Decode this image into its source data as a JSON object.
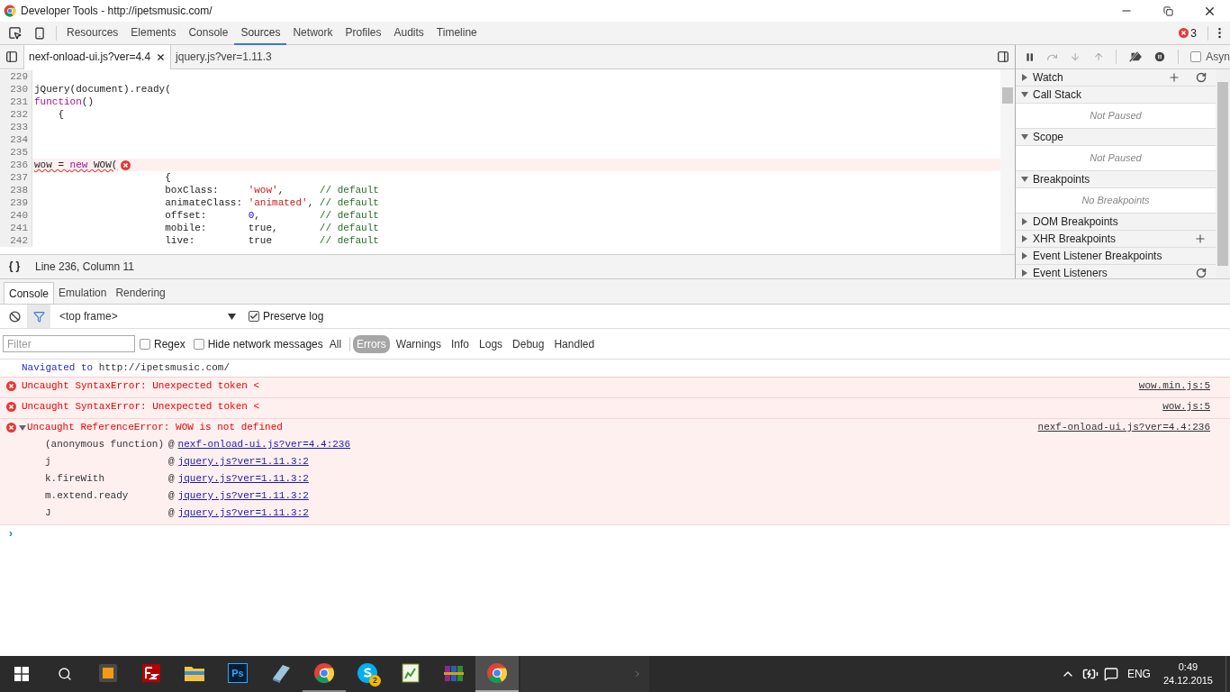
{
  "window": {
    "title": "Developer Tools - http://ipetsmusic.com/"
  },
  "main_tabs": [
    {
      "label": "Resources",
      "selected": false
    },
    {
      "label": "Elements",
      "selected": false
    },
    {
      "label": "Console",
      "selected": false
    },
    {
      "label": "Sources",
      "selected": true
    },
    {
      "label": "Network",
      "selected": false
    },
    {
      "label": "Profiles",
      "selected": false
    },
    {
      "label": "Audits",
      "selected": false
    },
    {
      "label": "Timeline",
      "selected": false
    }
  ],
  "error_count": "3",
  "file_tabs": [
    {
      "label": "nexf-onload-ui.js?ver=4.4",
      "selected": true,
      "closable": true
    },
    {
      "label": "jquery.js?ver=1.11.3",
      "selected": false,
      "closable": false
    }
  ],
  "code_lines": [
    {
      "number": "229",
      "error": false
    },
    {
      "number": "230",
      "error": false,
      "segments": [
        {
          "kind": "plain",
          "text": "jQuery(document).ready("
        }
      ]
    },
    {
      "number": "231",
      "error": false,
      "segments": [
        {
          "kind": "keyword",
          "text": "function"
        },
        {
          "kind": "plain",
          "text": "()"
        }
      ]
    },
    {
      "number": "232",
      "error": false,
      "segments": [
        {
          "kind": "plain",
          "text": "    {"
        }
      ]
    },
    {
      "number": "233",
      "error": false
    },
    {
      "number": "234",
      "error": false
    },
    {
      "number": "235",
      "error": false
    },
    {
      "number": "236",
      "error": true,
      "segments": [
        {
          "kind": "plain",
          "text": "wow = "
        },
        {
          "kind": "keyword",
          "text": "new"
        },
        {
          "kind": "plain",
          "text": " WOW("
        }
      ]
    },
    {
      "number": "237",
      "error": false,
      "segments": [
        {
          "kind": "plain",
          "text": "                      {"
        }
      ]
    },
    {
      "number": "238",
      "error": false,
      "segments": [
        {
          "kind": "plain",
          "text": "                      boxClass:     "
        },
        {
          "kind": "string",
          "text": "'wow'"
        },
        {
          "kind": "plain",
          "text": ",      "
        },
        {
          "kind": "comment",
          "text": "// default"
        }
      ]
    },
    {
      "number": "239",
      "error": false,
      "segments": [
        {
          "kind": "plain",
          "text": "                      animateClass: "
        },
        {
          "kind": "string",
          "text": "'animated'"
        },
        {
          "kind": "plain",
          "text": ", "
        },
        {
          "kind": "comment",
          "text": "// default"
        }
      ]
    },
    {
      "number": "240",
      "error": false,
      "segments": [
        {
          "kind": "plain",
          "text": "                      offset:       "
        },
        {
          "kind": "number",
          "text": "0"
        },
        {
          "kind": "plain",
          "text": ",          "
        },
        {
          "kind": "comment",
          "text": "// default"
        }
      ]
    },
    {
      "number": "241",
      "error": false,
      "segments": [
        {
          "kind": "plain",
          "text": "                      mobile:       true,       "
        },
        {
          "kind": "comment",
          "text": "// default"
        }
      ]
    },
    {
      "number": "242",
      "error": false,
      "segments": [
        {
          "kind": "plain",
          "text": "                      live:         true        "
        },
        {
          "kind": "comment",
          "text": "// default"
        }
      ]
    }
  ],
  "editor_status": {
    "position": "Line 236, Column 11"
  },
  "debug_toolbar": {
    "async_label": "Asyn",
    "async_checked": false
  },
  "sidebar_sections": [
    {
      "title": "Watch",
      "expanded": false,
      "add_button": true,
      "refresh_button": true
    },
    {
      "title": "Call Stack",
      "expanded": true,
      "message": "Not Paused"
    },
    {
      "title": "Scope",
      "expanded": true,
      "message": "Not Paused"
    },
    {
      "title": "Breakpoints",
      "expanded": true,
      "message": "No Breakpoints"
    },
    {
      "title": "DOM Breakpoints",
      "expanded": false
    },
    {
      "title": "XHR Breakpoints",
      "expanded": false,
      "add_button": true
    },
    {
      "title": "Event Listener Breakpoints",
      "expanded": false
    },
    {
      "title": "Event Listeners",
      "expanded": false,
      "refresh_button": true
    }
  ],
  "drawer_tabs": [
    {
      "label": "Console",
      "selected": true
    },
    {
      "label": "Emulation",
      "selected": false
    },
    {
      "label": "Rendering",
      "selected": false
    }
  ],
  "console_toolbar": {
    "context": "<top frame>",
    "preserve_log_label": "Preserve log",
    "preserve_log": true
  },
  "filter_bar": {
    "placeholder": "Filter",
    "regex_label": "Regex",
    "regex": false,
    "hide_network_label": "Hide network messages",
    "hide_network": false,
    "levels": [
      {
        "label": "All",
        "selected": false
      },
      {
        "label": "Errors",
        "selected": true
      },
      {
        "label": "Warnings",
        "selected": false
      },
      {
        "label": "Info",
        "selected": false
      },
      {
        "label": "Logs",
        "selected": false
      },
      {
        "label": "Debug",
        "selected": false
      },
      {
        "label": "Handled",
        "selected": false
      }
    ]
  },
  "messages": [
    {
      "kind": "info",
      "prefix": "Navigated to",
      "text": "http://ipetsmusic.com/"
    },
    {
      "kind": "error",
      "text": "Uncaught SyntaxError: Unexpected token <",
      "source": "wow.min.js:5"
    },
    {
      "kind": "error",
      "text": "Uncaught SyntaxError: Unexpected token <",
      "source": "wow.js:5"
    },
    {
      "kind": "error",
      "text": "Uncaught ReferenceError: WOW is not defined",
      "source": "nexf-onload-ui.js?ver=4.4:236",
      "expanded": true,
      "stack": [
        {
          "function": "(anonymous function)",
          "at": "@",
          "location": "nexf-onload-ui.js?ver=4.4:236"
        },
        {
          "function": "j",
          "at": "@",
          "location": "jquery.js?ver=1.11.3:2"
        },
        {
          "function": "k.fireWith",
          "at": "@",
          "location": "jquery.js?ver=1.11.3:2"
        },
        {
          "function": "m.extend.ready",
          "at": "@",
          "location": "jquery.js?ver=1.11.3:2"
        },
        {
          "function": "J",
          "at": "@",
          "location": "jquery.js?ver=1.11.3:2"
        }
      ]
    }
  ],
  "prompt": "›",
  "taskbar": {
    "apps": [
      {
        "kind": "sublime",
        "selected": false
      },
      {
        "kind": "filezilla",
        "selected": false
      },
      {
        "kind": "explorer",
        "selected": false
      },
      {
        "kind": "photoshop",
        "label": "Ps",
        "selected": false
      },
      {
        "kind": "notepad",
        "selected": false
      },
      {
        "kind": "chrome",
        "selected": false
      },
      {
        "kind": "skype",
        "badge": "2",
        "selected": false
      },
      {
        "kind": "editor",
        "selected": false
      },
      {
        "kind": "archiver",
        "selected": false
      },
      {
        "kind": "chrome",
        "selected": true
      }
    ],
    "language": "ENG",
    "time": "0:49",
    "date": "24.12.2015"
  }
}
